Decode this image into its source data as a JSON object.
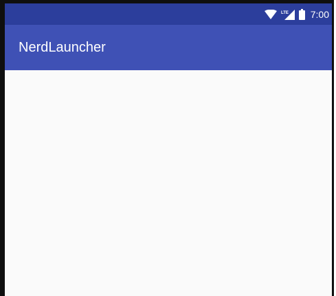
{
  "status_bar": {
    "time": "7:00",
    "network_label": "LTE",
    "icons": [
      "wifi-icon",
      "cellular-signal-icon",
      "battery-icon"
    ],
    "color": "#2c3e9c"
  },
  "app_bar": {
    "title": "NerdLauncher",
    "color": "#3f51b5"
  },
  "content": {
    "background": "#fafafa",
    "items": []
  }
}
